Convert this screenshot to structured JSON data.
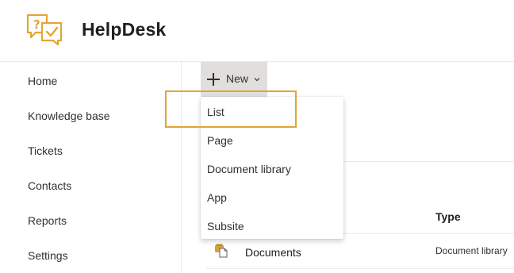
{
  "header": {
    "site_title": "HelpDesk",
    "logo_icon": "helpdesk-logo-icon",
    "accent_color": "#e3a535"
  },
  "sidebar": {
    "items": [
      {
        "label": "Home"
      },
      {
        "label": "Knowledge base"
      },
      {
        "label": "Tickets"
      },
      {
        "label": "Contacts"
      },
      {
        "label": "Reports"
      },
      {
        "label": "Settings"
      }
    ]
  },
  "toolbar": {
    "new_label": "New",
    "new_icon": "plus-icon",
    "chevron_icon": "chevron-down-icon"
  },
  "new_menu": {
    "items": [
      {
        "label": "List"
      },
      {
        "label": "Page"
      },
      {
        "label": "Document library"
      },
      {
        "label": "App"
      },
      {
        "label": "Subsite"
      }
    ],
    "highlighted_item": "List"
  },
  "content": {
    "columns": {
      "type": "Type"
    },
    "rows": [
      {
        "name": "Documents",
        "type": "Document library",
        "icon": "document-library-icon"
      }
    ]
  }
}
